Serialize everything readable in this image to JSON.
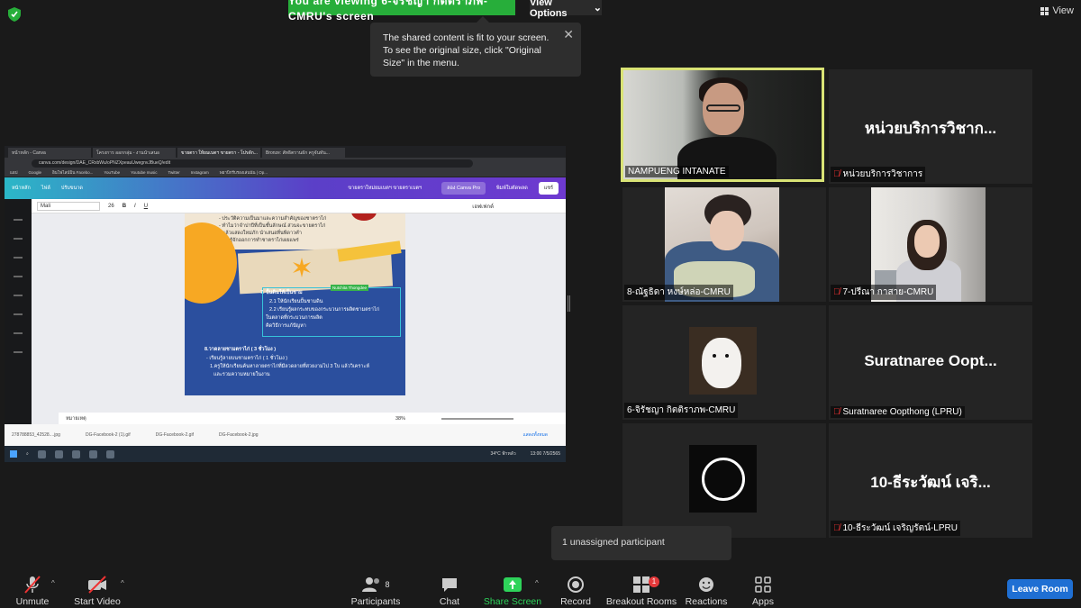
{
  "top": {
    "banner": "You are viewing 6-จิรัชญา กิตติราภพ-CMRU's screen",
    "view_options": "View Options",
    "view_label": "View"
  },
  "tooltip": {
    "text": "The shared content is fit to your screen. To see the original size, click \"Original Size\" in the menu."
  },
  "shared_screen": {
    "tabs": [
      "หน้าหลัก - Canva",
      "โครงการ ออกกลุ่ม - งานนำเสนอ",
      "ขายตรา ให้ยมเบตฯ ขายตรา - โปรดัก...",
      "Bronze: สัทธิตรานธัก ครูจันทัน..."
    ],
    "url": "canva.com/design/DAE_CRxbWu/oPNZXpeauUwegnvJBueQ/edit",
    "bookmarks": [
      "แอป",
      "Google",
      "อินโฟไลน์บิน Facebo...",
      "YouTube",
      "Youtube music",
      "Twitter",
      "Instagram",
      "พยาบิกรีบรองเล่นนัน | Op..."
    ],
    "canva_left": [
      "หน้าหลัก",
      "ไฟล์",
      "ปรับขนาด"
    ],
    "canva_title": "ขายตราใหม่ยมเบตฯ ขายตราเบตฯ",
    "canva_pro": "ลอง Canva Pro",
    "canva_publish": "พิมพ์ใบตัดพลด",
    "canva_share": "แชร์",
    "font_name": "Mali",
    "font_size": "26",
    "effects": "เอฟเฟกต์",
    "slide_lines": [
      "- ประวัติความเป็นมาและความสำคัญของชาตราไก่",
      "- ทำไมว่าจำปาปีที่เป็นชั้นลักษณ์ ส่วนจะขายตราไก่",
      "• ออกไปแล้วแสดงใหม่ภัก นำเสนอที่นพีดาวคำ",
      "- เพื่อรู้จักออกการทำชาตราไก่เผยแพร่"
    ],
    "slide_section1": "7. ปั้นดินให้เป็นชาม",
    "slide_section1_lines": [
      "2.1 ให้นักเรียนปั้นชามดิน",
      "2.2 เรียนรู้ผลกระทบของกระบวนการผลิตชามตราไก่",
      "ในตลาดที่กระบวนการผลิต",
      "คิดวิธีการแก้ปัญหา"
    ],
    "slide_section2": "8.วาดลายชามตราไก่ ( 3 ชั่วโมง )",
    "slide_section2_lines": [
      "- เรียนรู้ลายบนชามตราไก่ ( 1 ชั่วโมง )",
      "1.ครูให้นักเรียนค้นหาลายตราไก่ที่มีลวดลายที่สวยงามไป 3 ใบ แล้ววิเคราะห์",
      "และรวมความหมายในงาน"
    ],
    "sel_tag": "Nutchita Thongdee",
    "notes": "หมายเหตุ",
    "zoom": "38%",
    "downloads": [
      "278788853_42528....jpg",
      "DG-Facebook-2 (1).gif",
      "DG-Facebook-2.gif",
      "DG-Facebook-2.jpg"
    ],
    "download_more": "แสดงทั้งหมด",
    "tray_temp": "34°C",
    "tray_weather": "ฟ้าหลัว",
    "tray_time": "13:00",
    "tray_date": "7/5/2565"
  },
  "gallery": [
    {
      "name": "NAMPUENG INTANATE",
      "muted": false,
      "active": true
    },
    {
      "name": "หน่วยบริการวิชาการ",
      "display": "หน่วยบริการวิชาก...",
      "muted": true
    },
    {
      "name": "8-ณัฐธิดา หงษ์หล่อ-CMRU",
      "muted": false
    },
    {
      "name": "7-ปรีณา กาสาย-CMRU",
      "muted": true
    },
    {
      "name": "6-จิรัชญา กิตติราภพ-CMRU",
      "muted": false
    },
    {
      "name": "Suratnaree Oopthong (LPRU)",
      "display": "Suratnaree  Oopt...",
      "muted": true
    },
    {
      "name": "10-ธีระวัฒน์ เจริญรัตน์-LPRU",
      "display": "10-ธีระวัฒน์ เจริ...",
      "muted": true
    }
  ],
  "unassigned": "1 unassigned participant",
  "toolbar": {
    "unmute": "Unmute",
    "start_video": "Start Video",
    "participants": "Participants",
    "participants_count": "8",
    "chat": "Chat",
    "share_screen": "Share Screen",
    "record": "Record",
    "breakout_rooms": "Breakout Rooms",
    "breakout_badge": "1",
    "reactions": "Reactions",
    "apps": "Apps",
    "leave": "Leave Room"
  },
  "colors": {
    "banner_green": "#27ae3a",
    "active_speaker": "#d9e375",
    "leave_blue": "#1f6fd3",
    "share_green": "#2ed35a",
    "mute_red": "#e33333"
  }
}
